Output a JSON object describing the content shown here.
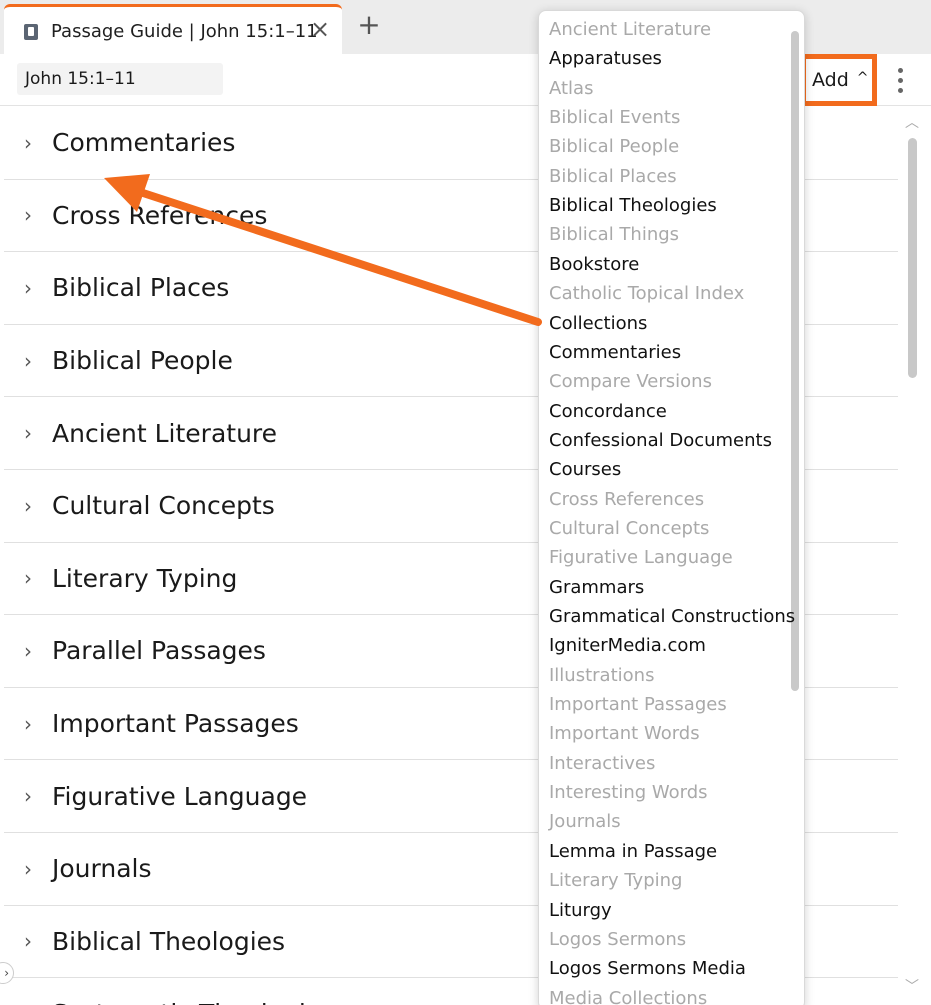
{
  "tab": {
    "title": "Passage Guide | John 15:1–11",
    "close_glyph": "×",
    "new_tab_glyph": "+"
  },
  "toolbar": {
    "reference": "John 15:1–11",
    "add_label": "Add",
    "add_caret": "^"
  },
  "sections": [
    "Commentaries",
    "Cross References",
    "Biblical Places",
    "Biblical People",
    "Ancient Literature",
    "Cultural Concepts",
    "Literary Typing",
    "Parallel Passages",
    "Important Passages",
    "Figurative Language",
    "Journals",
    "Biblical Theologies",
    "Systematic Theologies"
  ],
  "dropdown": {
    "items": [
      {
        "label": "Ancient Literature",
        "enabled": false
      },
      {
        "label": "Apparatuses",
        "enabled": true
      },
      {
        "label": "Atlas",
        "enabled": false
      },
      {
        "label": "Biblical Events",
        "enabled": false
      },
      {
        "label": "Biblical People",
        "enabled": false
      },
      {
        "label": "Biblical Places",
        "enabled": false
      },
      {
        "label": "Biblical Theologies",
        "enabled": true
      },
      {
        "label": "Biblical Things",
        "enabled": false
      },
      {
        "label": "Bookstore",
        "enabled": true
      },
      {
        "label": "Catholic Topical Index",
        "enabled": false
      },
      {
        "label": "Collections",
        "enabled": true
      },
      {
        "label": "Commentaries",
        "enabled": true
      },
      {
        "label": "Compare Versions",
        "enabled": false
      },
      {
        "label": "Concordance",
        "enabled": true
      },
      {
        "label": "Confessional Documents",
        "enabled": true
      },
      {
        "label": "Courses",
        "enabled": true
      },
      {
        "label": "Cross References",
        "enabled": false
      },
      {
        "label": "Cultural Concepts",
        "enabled": false
      },
      {
        "label": "Figurative Language",
        "enabled": false
      },
      {
        "label": "Grammars",
        "enabled": true
      },
      {
        "label": "Grammatical Constructions",
        "enabled": true
      },
      {
        "label": "IgniterMedia.com",
        "enabled": true
      },
      {
        "label": "Illustrations",
        "enabled": false
      },
      {
        "label": "Important Passages",
        "enabled": false
      },
      {
        "label": "Important Words",
        "enabled": false
      },
      {
        "label": "Interactives",
        "enabled": false
      },
      {
        "label": "Interesting Words",
        "enabled": false
      },
      {
        "label": "Journals",
        "enabled": false
      },
      {
        "label": "Lemma in Passage",
        "enabled": true
      },
      {
        "label": "Literary Typing",
        "enabled": false
      },
      {
        "label": "Liturgy",
        "enabled": true
      },
      {
        "label": "Logos Sermons",
        "enabled": false
      },
      {
        "label": "Logos Sermons Media",
        "enabled": true
      },
      {
        "label": "Media Collections",
        "enabled": false
      }
    ]
  },
  "colors": {
    "accent": "#f26b1d",
    "disabled_text": "#a9a9a9",
    "enabled_text": "#111111"
  }
}
